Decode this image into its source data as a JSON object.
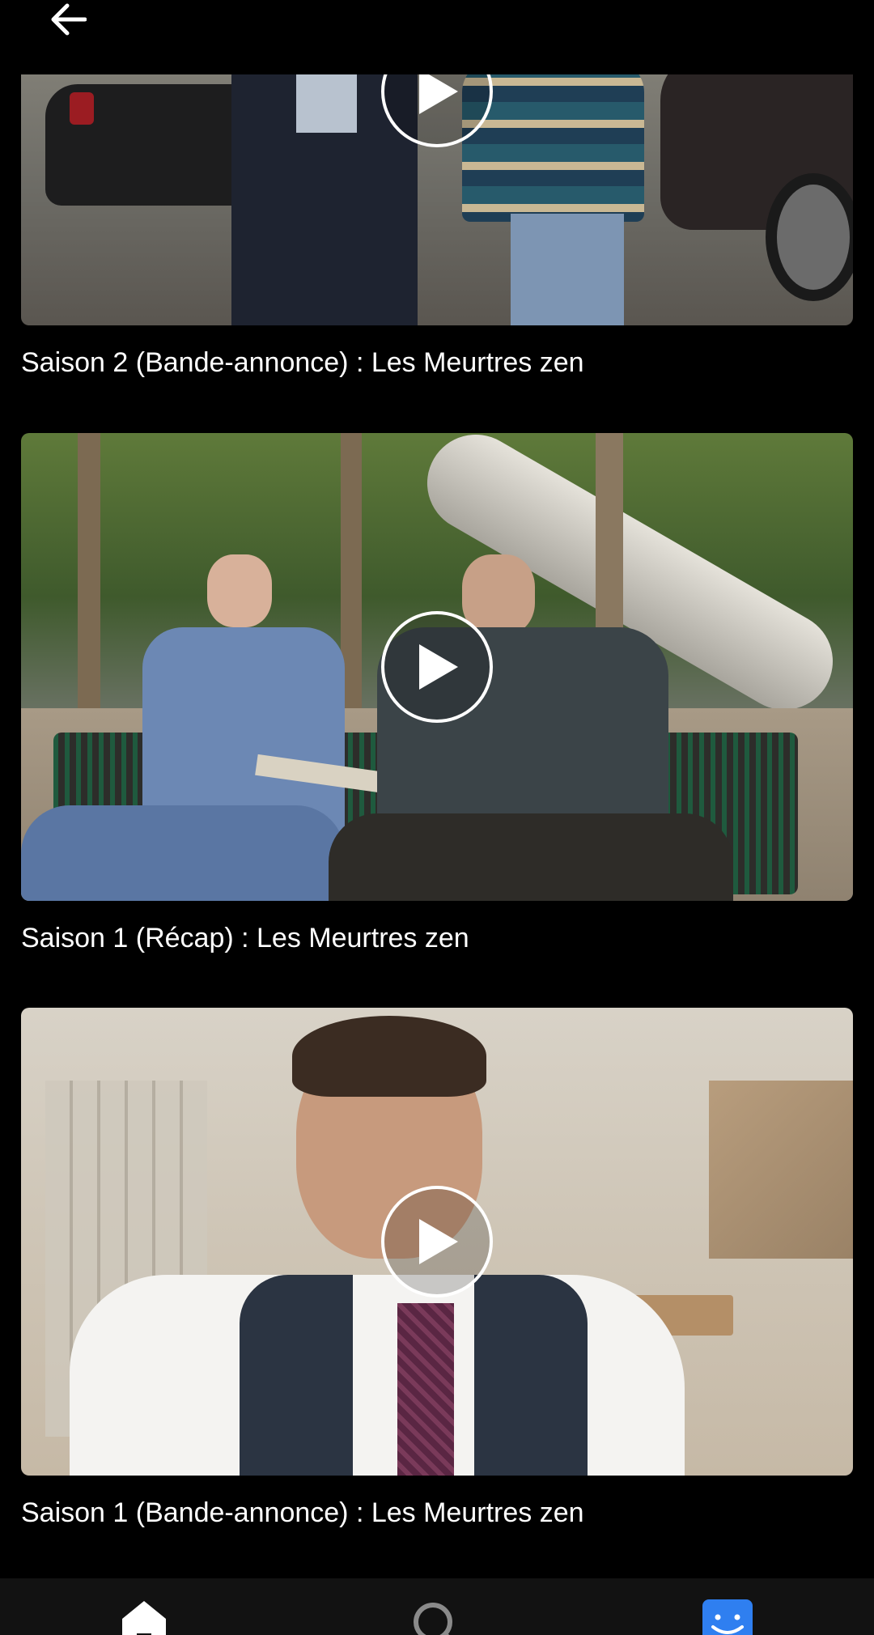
{
  "header": {
    "back_icon": "arrow-left-icon"
  },
  "videos": [
    {
      "title": "Saison 2 (Bande-annonce) : Les Meurtres zen",
      "play_icon": "play-icon"
    },
    {
      "title": "Saison 1 (Récap) : Les Meurtres zen",
      "play_icon": "play-icon"
    },
    {
      "title": "Saison 1 (Bande-annonce) : Les Meurtres zen",
      "play_icon": "play-icon"
    }
  ],
  "bottom_nav": {
    "items": [
      {
        "icon": "home-icon"
      },
      {
        "icon": "search-icon"
      },
      {
        "icon": "profile-icon"
      }
    ]
  },
  "colors": {
    "background": "#000000",
    "text": "#ffffff",
    "nav_background": "#121212",
    "profile_accent": "#2f7ff0"
  }
}
